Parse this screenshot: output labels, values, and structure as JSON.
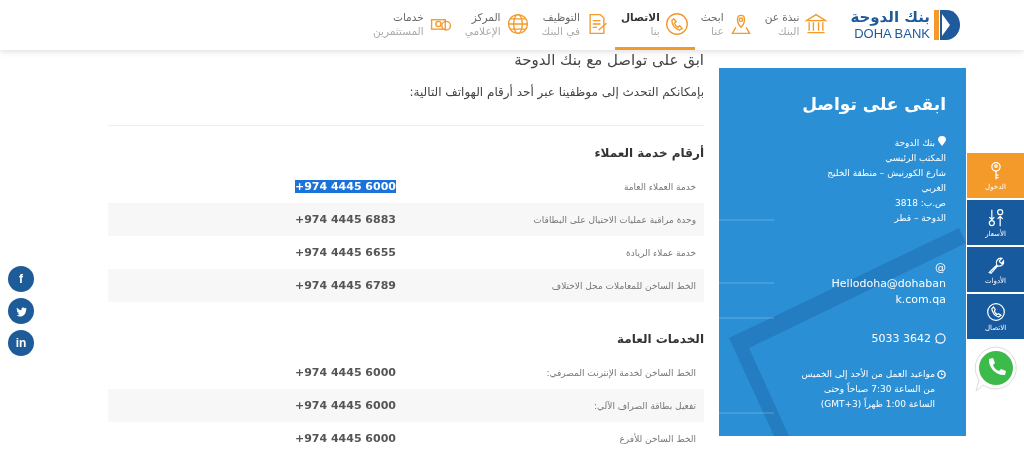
{
  "logo": {
    "arabic": "بنك الدوحة",
    "latin": "DOHA BANK"
  },
  "nav": [
    {
      "kind": "bank",
      "line1": "نبذة عن",
      "line2": "البنك",
      "selected": false
    },
    {
      "kind": "pin",
      "line1": "ابحث",
      "line2": "عنا",
      "selected": false
    },
    {
      "kind": "phone",
      "line1": "الاتصال",
      "line2": "بنا",
      "selected": true
    },
    {
      "kind": "doc",
      "line1": "التوظيف",
      "line2": "في البنك",
      "selected": false
    },
    {
      "kind": "globe",
      "line1": "المركز",
      "line2": "الإعلامي",
      "selected": false
    },
    {
      "kind": "money",
      "line1": "خدمات",
      "line2": "المستثمرين",
      "selected": false
    }
  ],
  "page_title": "ابق على تواصل مع بنك الدوحة",
  "intro": "بإمكانكم التحدث إلى موظفينا عبر أحد أرقام الهواتف التالية:",
  "sections": [
    {
      "title": "أرقام خدمة العملاء",
      "rows": [
        {
          "label": "خدمة العملاء العامة",
          "number": "+974 4445 6000",
          "selected": true
        },
        {
          "label": "وحدة مراقبة عمليات الاحتيال على البطاقات",
          "number": "+974 4445 6883",
          "selected": false
        },
        {
          "label": "خدمة عملاء الريادة",
          "number": "+974 4445 6655",
          "selected": false
        },
        {
          "label": "الخط الساخن للمعاملات محل الاختلاف",
          "number": "+974 4445 6789",
          "selected": false
        }
      ]
    },
    {
      "title": "الخدمات العامة",
      "rows": [
        {
          "label": "الخط الساخن لخدمة الإنترنت المصرفي:",
          "number": "+974 4445 6000",
          "selected": false
        },
        {
          "label": "تفعيل بطاقة الصراف الآلي:",
          "number": "+974 4445 6000",
          "selected": false
        },
        {
          "label": "الخط الساخن للأفرع",
          "number": "+974 4445 6000",
          "selected": false
        }
      ]
    }
  ],
  "contact": {
    "title": "ابقى على تواصل",
    "address": [
      "بنك الدوحة",
      "المكتب الرئيسي",
      "شارع الكورنيش – منطقة الخليج الغربي",
      "ص.ب: 3818",
      "الدوحة – قطر"
    ],
    "email_mark": "@",
    "email": "Hellodoha@dohabank.com.qa",
    "whatsapp": "5033 3642",
    "hours": "مواعيد العمل من الأحد إلى الخميس من الساعة 7:30 صباحاً وحتى الساعة 1:00 ظهراً (GMT+3)"
  },
  "side_tabs": [
    {
      "kind": "key",
      "label": "الدخول",
      "selected": true
    },
    {
      "kind": "rates",
      "label": "الأسعار",
      "selected": false
    },
    {
      "kind": "tools",
      "label": "الأدوات",
      "selected": false
    },
    {
      "kind": "call",
      "label": "الاتصال",
      "selected": false
    }
  ],
  "social": [
    {
      "kind": "facebook",
      "label": "f"
    },
    {
      "kind": "twitter"
    },
    {
      "kind": "linkedin",
      "label": "in"
    }
  ]
}
